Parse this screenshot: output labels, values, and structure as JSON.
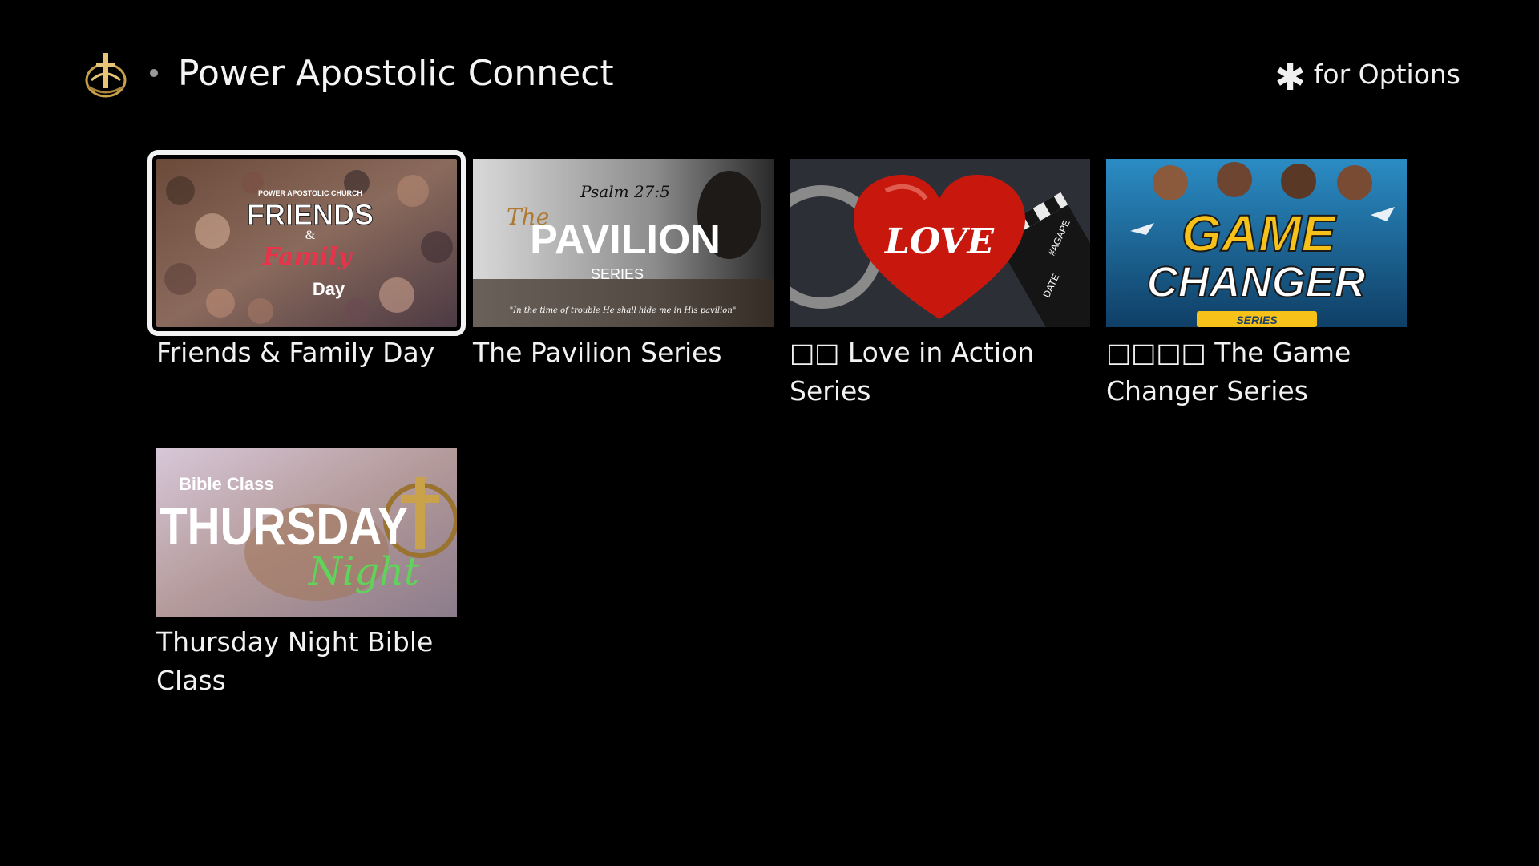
{
  "header": {
    "app_title": "Power Apostolic Connect",
    "options_hint": "for Options",
    "logo_icon": "church-cross-emblem-icon",
    "options_icon": "asterisk-icon"
  },
  "tiles": [
    {
      "label": "Friends & Family Day",
      "thumb_text": [
        "POWER APOSTOLIC CHURCH",
        "FRIENDS",
        "&",
        "Family",
        "Day"
      ],
      "selected": true
    },
    {
      "label": "The Pavilion Series",
      "thumb_text": [
        "Psalm 27:5",
        "The",
        "PAVILION",
        "SERIES",
        "\"In the time of trouble He shall hide me in His pavilion\""
      ],
      "selected": false
    },
    {
      "label": "□□ Love in Action Series",
      "thumb_text": [
        "LOVE",
        "#AGAPE",
        "DATE"
      ],
      "selected": false
    },
    {
      "label": "□□□□ The Game Changer Series",
      "thumb_text": [
        "GAME",
        "CHANGER",
        "SERIES"
      ],
      "selected": false
    },
    {
      "label": "Thursday Night Bible Class",
      "thumb_text": [
        "Bible Class",
        "THURSDAY",
        "Night"
      ],
      "selected": false
    }
  ],
  "colors": {
    "background": "#000000",
    "text": "#f2f2f2",
    "focus_outline": "#f2f2f2",
    "logo_gold": "#c9a24a",
    "game_changer_yellow": "#f6c21a",
    "game_changer_blue": "#1b6fa8",
    "love_red": "#c8180e",
    "thursday_green": "#5fd35a"
  }
}
